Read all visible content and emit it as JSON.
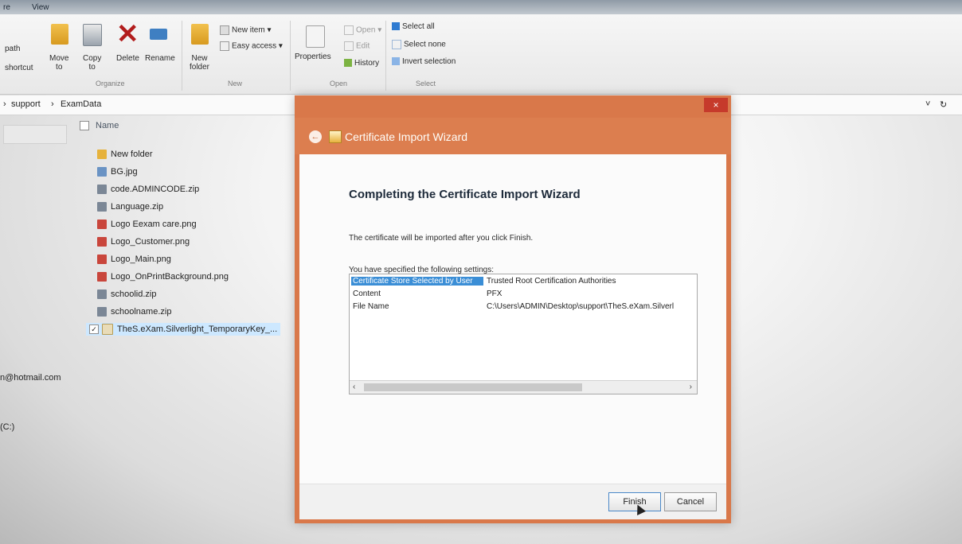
{
  "menu": {
    "left_fragment": "re",
    "view": "View"
  },
  "ribbon": {
    "left_labels": [
      "path",
      "shortcut"
    ],
    "move": "Move\nto",
    "copy": "Copy\nto",
    "delete": "Delete",
    "rename": "Rename",
    "new_folder": "New\nfolder",
    "new_item": "New item",
    "easy_access": "Easy access",
    "properties": "Properties",
    "open": "Open",
    "edit": "Edit",
    "history": "History",
    "select_all": "Select all",
    "select_none": "Select none",
    "invert_selection": "Invert selection",
    "groups": {
      "organize": "Organize",
      "new": "New",
      "open": "Open",
      "select": "Select"
    }
  },
  "address": {
    "path_1": "support",
    "path_2": "ExamData"
  },
  "left_pane": {
    "email": "n@hotmail.com",
    "drive": "(C:)"
  },
  "file_list": {
    "header": "Name",
    "files": [
      "New folder",
      "BG.jpg",
      "code.ADMINCODE.zip",
      "Language.zip",
      "Logo Eexam care.png",
      "Logo_Customer.png",
      "Logo_Main.png",
      "Logo_OnPrintBackground.png",
      "schoolid.zip",
      "schoolname.zip",
      "TheS.eXam.Silverlight_TemporaryKey_..."
    ]
  },
  "dialog": {
    "title": "Certificate Import Wizard",
    "heading": "Completing the Certificate Import Wizard",
    "description": "The certificate will be imported after you click Finish.",
    "settings_label": "You have specified the following settings:",
    "settings": [
      {
        "key": "Certificate Store Selected by User",
        "value": "Trusted Root Certification Authorities"
      },
      {
        "key": "Content",
        "value": "PFX"
      },
      {
        "key": "File Name",
        "value": "C:\\Users\\ADMIN\\Desktop\\support\\TheS.eXam.Silverl"
      }
    ],
    "finish": "Finish",
    "cancel": "Cancel",
    "close": "×"
  },
  "colors": {
    "dialog_accent": "#d9784a",
    "selection": "#3b8ed6"
  }
}
